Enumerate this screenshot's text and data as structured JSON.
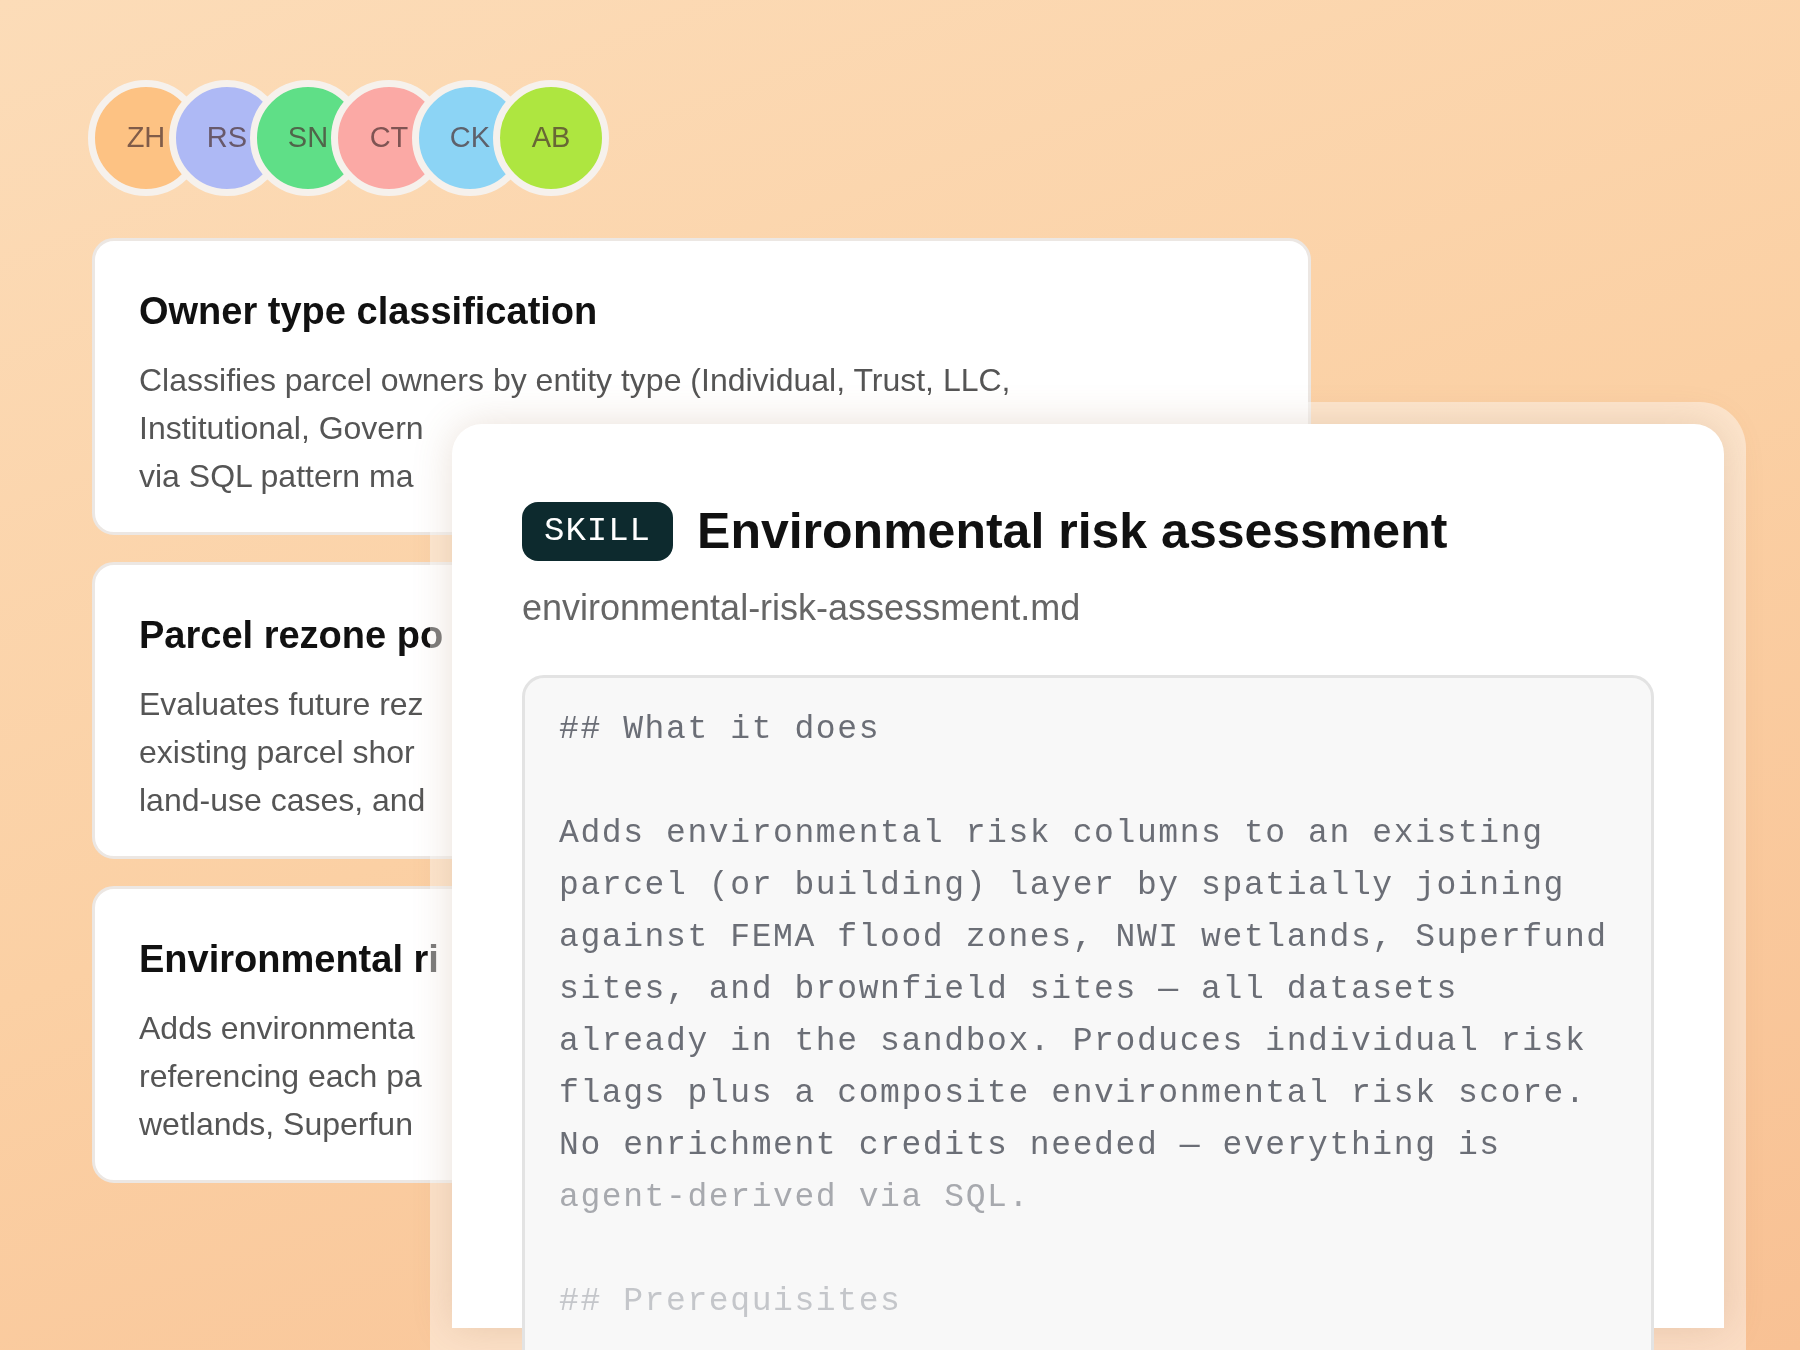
{
  "avatars": [
    {
      "initials": "ZH",
      "color": "#fdc283"
    },
    {
      "initials": "RS",
      "color": "#aeb9f5"
    },
    {
      "initials": "SN",
      "color": "#5fdf87"
    },
    {
      "initials": "CT",
      "color": "#fba9a5"
    },
    {
      "initials": "CK",
      "color": "#8cd4f5"
    },
    {
      "initials": "AB",
      "color": "#aee640"
    }
  ],
  "skill_cards": [
    {
      "title": "Owner type classification",
      "lines": [
        "Classifies parcel owners by entity type (Individual, Trust, LLC,",
        "Institutional, Govern",
        "via SQL pattern ma"
      ]
    },
    {
      "title": "Parcel rezone po",
      "lines": [
        "Evaluates future rez",
        "existing parcel shor",
        "land-use cases, and"
      ]
    },
    {
      "title": "Environmental ri",
      "lines": [
        "Adds environmenta",
        "referencing each pa",
        "wetlands, Superfun"
      ]
    }
  ],
  "detail": {
    "badge": "SKILL",
    "title": "Environmental risk assessment",
    "filename": "environmental-risk-assessment.md",
    "content": [
      {
        "kind": "heading",
        "lines": [
          "## What it does"
        ]
      },
      {
        "kind": "paragraph",
        "lines": [
          "Adds environmental risk columns to an existing",
          "parcel (or building) layer by spatially joining",
          "against FEMA flood zones, NWI wetlands, Superfund",
          "sites, and brownfield sites — all datasets",
          "already in the sandbox. Produces individual risk",
          "flags plus a composite environmental risk score.",
          "No enrichment credits needed — everything is",
          "agent-derived via SQL."
        ]
      },
      {
        "kind": "heading",
        "lines": [
          "## Prerequisites"
        ]
      }
    ]
  }
}
